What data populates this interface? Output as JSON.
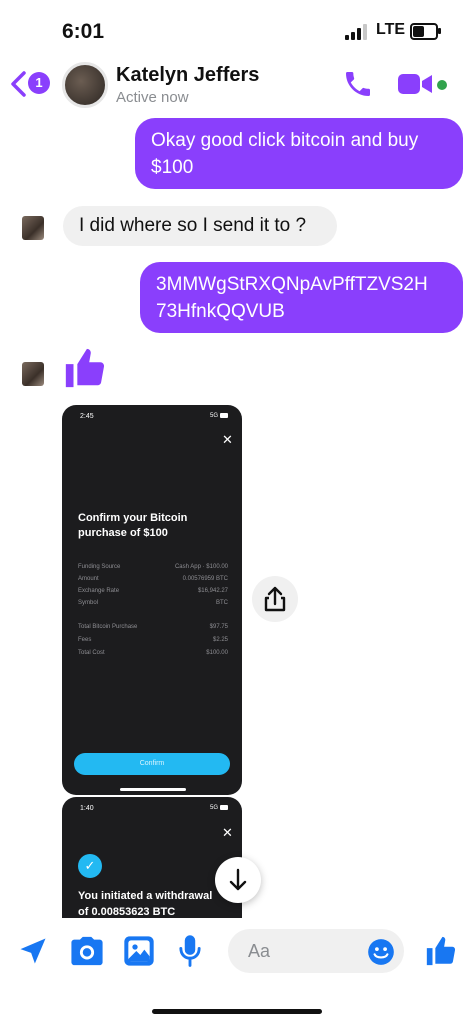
{
  "status": {
    "time": "6:01",
    "network": "LTE"
  },
  "header": {
    "back_count": "1",
    "contact_name": "Katelyn Jeffers",
    "presence": "Active now"
  },
  "messages": [
    {
      "direction": "out",
      "lines": [
        "Okay good click bitcoin and buy",
        "$100"
      ]
    },
    {
      "direction": "in",
      "text": "I did where so I send it to ?"
    },
    {
      "direction": "out",
      "lines": [
        "3MMWgStRXQNpAvPffTZVS2H",
        "73HfnkQQVUB"
      ]
    }
  ],
  "screenshot1": {
    "time": "2:45",
    "net": "5G",
    "title_line1": "Confirm your Bitcoin",
    "title_line2": "purchase of $100",
    "rows": [
      {
        "label": "Funding Source",
        "value": "Cash App · $100.00"
      },
      {
        "label": "Amount",
        "value": "0.00576959 BTC"
      },
      {
        "label": "Exchange Rate",
        "value": "$16,942.27"
      },
      {
        "label": "Symbol",
        "value": "BTC"
      }
    ],
    "rows2": [
      {
        "label": "Total Bitcoin Purchase",
        "value": "$97.75"
      },
      {
        "label": "Fees",
        "value": "$2.25"
      },
      {
        "label": "Total Cost",
        "value": "$100.00"
      }
    ],
    "confirm_label": "Confirm"
  },
  "screenshot2": {
    "time": "1:40",
    "net": "5G",
    "line1": "You initiated a withdrawal",
    "line2": "of 0.00853623 BTC"
  },
  "composer": {
    "placeholder": "Aa"
  },
  "colors": {
    "accent": "#8a3ffc",
    "composer_icons": "#1877f2",
    "cash_app_blue": "#23b9f2"
  }
}
